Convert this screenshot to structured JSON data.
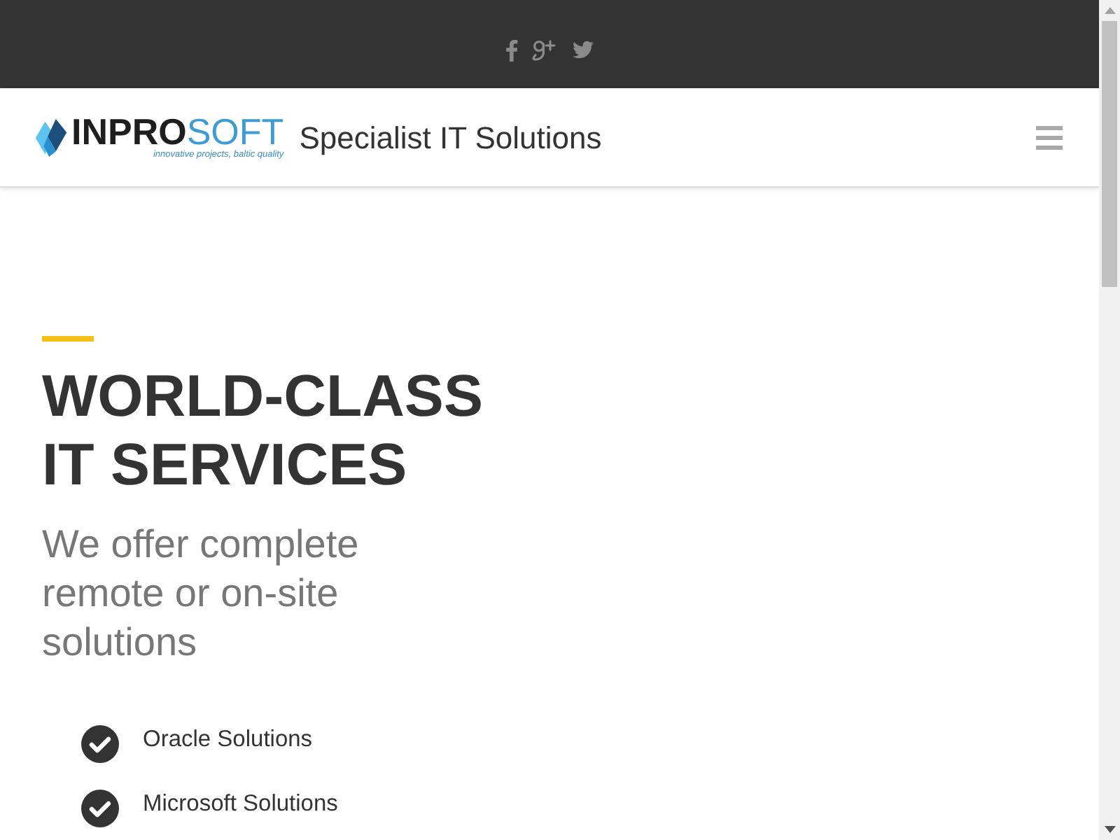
{
  "header": {
    "logo": {
      "wordmark": [
        "INPRO",
        "SOFT"
      ],
      "tagline": "innovative projects, baltic quality"
    },
    "site_title": "Specialist IT Solutions"
  },
  "hero": {
    "heading": "WORLD-CLASS IT SERVICES",
    "subheading": "We offer complete remote or on-site solutions",
    "features": [
      "Oracle Solutions",
      "Microsoft Solutions"
    ]
  }
}
